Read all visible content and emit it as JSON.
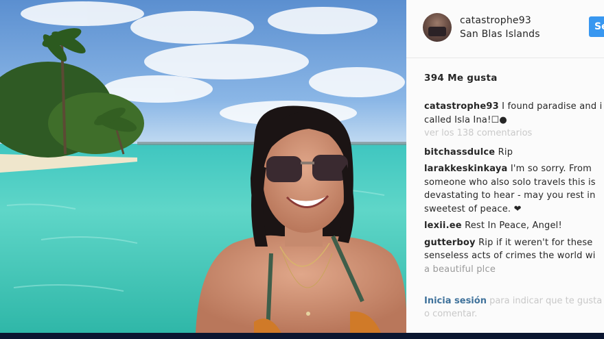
{
  "post": {
    "username": "catastrophe93",
    "location": "San Blas Islands",
    "follow_label": "Se",
    "likes": "394 Me gusta",
    "caption": {
      "user": "catastrophe93",
      "text": " I found paradise and i",
      "text2": "called Isla Ina!☐●"
    },
    "view_all": "ver los 138 comentarios",
    "comments": [
      {
        "user": "bitchassdulce",
        "lines": [
          " Rip"
        ]
      },
      {
        "user": "larakkeskinkaya",
        "lines": [
          " I'm so sorry. From",
          "someone who also solo travels this is",
          "devastating to hear - may you rest in",
          "sweetest of peace. ❤"
        ]
      },
      {
        "user": "lexii.ee",
        "lines": [
          " Rest In Peace, Angel!"
        ]
      },
      {
        "user": "gutterboy",
        "lines": [
          " Rip if it weren't for these",
          "senseless acts of crimes the world wi",
          "a beautiful plce"
        ]
      }
    ],
    "login": {
      "link": "Inicia sesión",
      "text": " para indicar que te gusta",
      "text2": "o comentar."
    }
  },
  "icons": {
    "avatar": "profile-avatar",
    "heart": "heart-icon"
  },
  "colors": {
    "follow": "#3897f0",
    "link": "#3f729b"
  }
}
